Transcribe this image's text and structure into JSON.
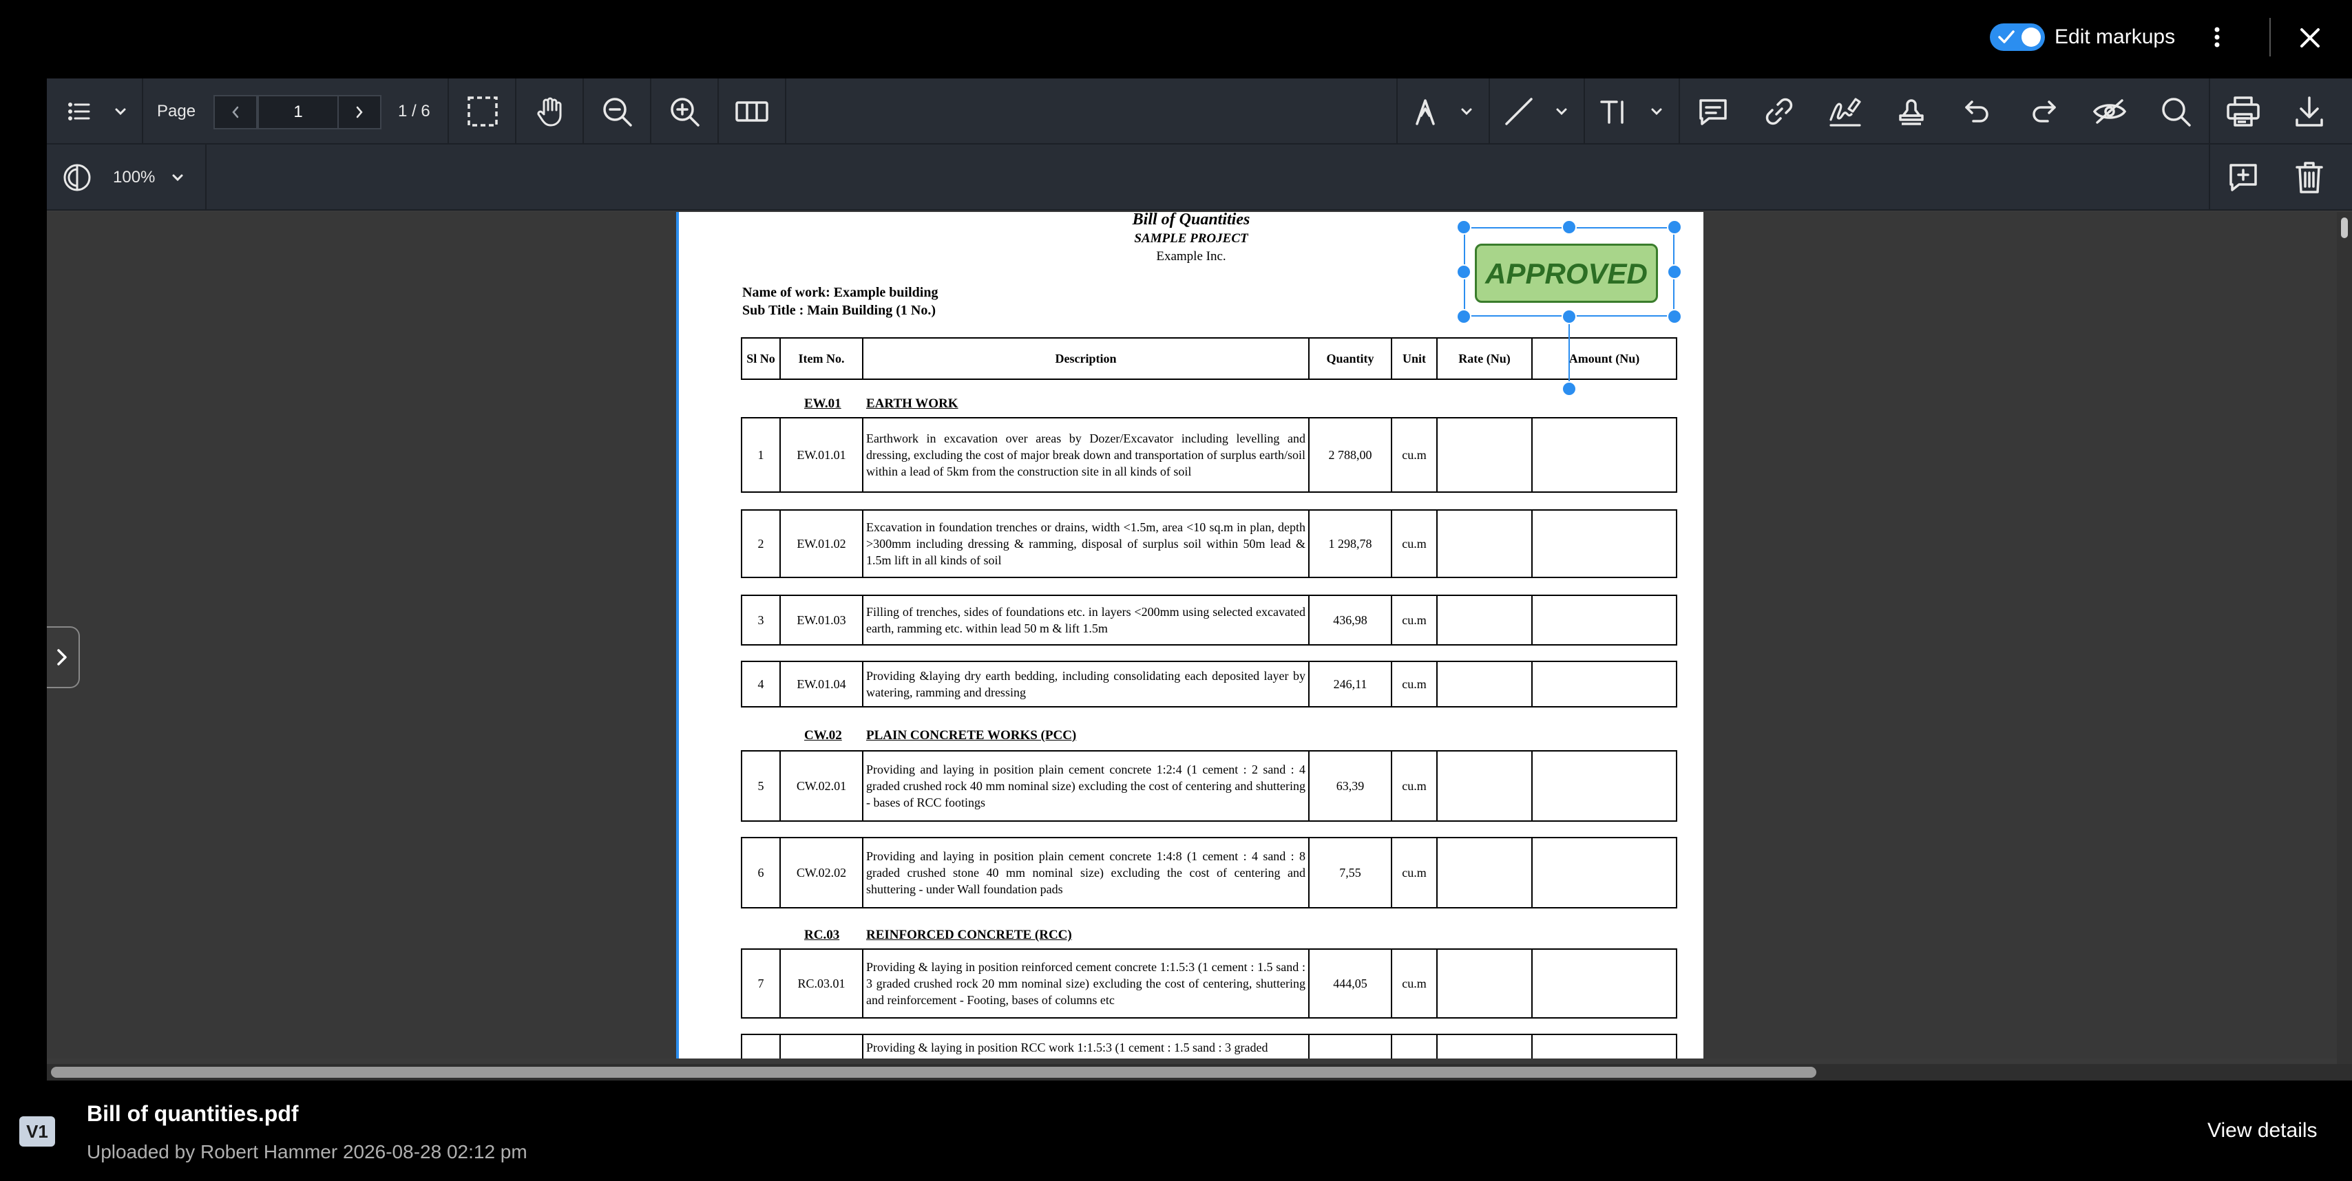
{
  "topbar": {
    "edit_markups_label": "Edit markups",
    "edit_markups_enabled": true
  },
  "toolbar": {
    "page_label": "Page",
    "current_page": "1",
    "page_count": "1 / 6",
    "zoom": "100%"
  },
  "document": {
    "title": "Bill of Quantities",
    "project": "SAMPLE PROJECT",
    "company": "Example Inc.",
    "name_of_work": "Name of work: Example building",
    "sub_title": "Sub Title : Main Building (1 No.)",
    "columns": [
      "Sl No",
      "Item No.",
      "Description",
      "Quantity",
      "Unit",
      "Rate (Nu)",
      "Amount (Nu)"
    ],
    "sections": [
      {
        "code": "EW.01",
        "name": "EARTH WORK"
      },
      {
        "code": "CW.02",
        "name": "PLAIN CONCRETE WORKS (PCC)"
      },
      {
        "code": "RC.03",
        "name": "REINFORCED  CONCRETE (RCC)"
      }
    ],
    "rows": [
      {
        "sl": "1",
        "item": "EW.01.01",
        "desc": "Earthwork in excavation over areas by Dozer/Excavator including levelling and dressing, excluding the cost of major break down and transportation of surplus earth/soil within a lead of 5km from the construction site in all kinds of soil",
        "qty": "2 788,00",
        "unit": "cu.m"
      },
      {
        "sl": "2",
        "item": "EW.01.02",
        "desc": "Excavation in foundation trenches or drains, width <1.5m, area <10 sq.m in plan, depth >300mm including dressing & ramming, disposal of surplus soil within 50m lead & 1.5m lift  in all kinds of soil",
        "qty": "1 298,78",
        "unit": "cu.m"
      },
      {
        "sl": "3",
        "item": "EW.01.03",
        "desc": "Filling of trenches, sides of foundations etc. in layers <200mm using selected excavated earth, ramming etc. within lead 50 m & lift 1.5m",
        "qty": "436,98",
        "unit": "cu.m"
      },
      {
        "sl": "4",
        "item": "EW.01.04",
        "desc": "Providing &laying dry earth bedding, including consolidating each deposited layer by watering, ramming and dressing",
        "qty": "246,11",
        "unit": "cu.m"
      },
      {
        "sl": "5",
        "item": "CW.02.01",
        "desc": "Providing and laying in position plain cement concrete 1:2:4 (1 cement : 2 sand : 4 graded crushed rock 40 mm nominal size) excluding the cost of centering and shuttering - bases of RCC footings",
        "qty": "63,39",
        "unit": "cu.m"
      },
      {
        "sl": "6",
        "item": "CW.02.02",
        "desc": "Providing and laying in position plain cement concrete 1:4:8 (1 cement : 4 sand : 8 graded crushed stone 40 mm nominal size) excluding the cost of centering and shuttering - under Wall foundation pads",
        "qty": "7,55",
        "unit": "cu.m"
      },
      {
        "sl": "7",
        "item": "RC.03.01",
        "desc": "Providing & laying in position reinforced cement concrete 1:1.5:3 (1 cement : 1.5 sand : 3 graded crushed rock 20 mm nominal size) excluding the cost of centering, shuttering and reinforcement - Footing, bases of columns etc",
        "qty": "444,05",
        "unit": "cu.m"
      },
      {
        "sl": "",
        "item": "",
        "desc": "Providing & laying in position RCC work 1:1.5:3 (1 cement : 1.5 sand : 3 graded",
        "qty": "",
        "unit": ""
      }
    ]
  },
  "stamp": {
    "text": "APPROVED",
    "fill_color": "#a8d58a",
    "text_color": "#2c6e24"
  },
  "file": {
    "version": "V1",
    "name": "Bill of quantities.pdf",
    "uploaded": "Uploaded by Robert Hammer  2026-08-28 02:12 pm",
    "view_details": "View details"
  },
  "colors": {
    "accent": "#2b8ef0",
    "toolbar": "#282d35"
  }
}
